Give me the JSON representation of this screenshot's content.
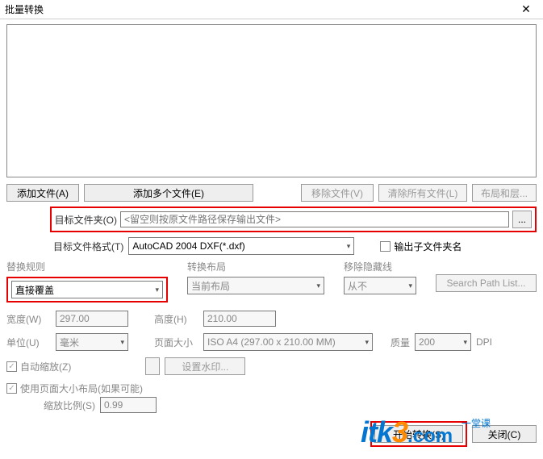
{
  "title": "批量转换",
  "close_icon": "✕",
  "buttons": {
    "add_file": "添加文件(A)",
    "add_multi": "添加多个文件(E)",
    "remove_file": "移除文件(V)",
    "clear_all": "清除所有文件(L)",
    "layout_layer": "布局和层...",
    "browse": "...",
    "watermark": "设置水印...",
    "search_path": "Search Path List...",
    "start": "开始转换(S)",
    "close": "关闭(C)"
  },
  "labels": {
    "target_folder": "目标文件夹(O)",
    "target_format": "目标文件格式(T)",
    "output_subfolder": "输出子文件夹名",
    "replace_rule": "替换规则",
    "convert_layout": "转换布局",
    "remove_hidden": "移除隐藏线",
    "width": "宽度(W)",
    "height": "高度(H)",
    "unit": "单位(U)",
    "page_size": "页面大小",
    "quality": "质量",
    "dpi": "DPI",
    "auto_scale": "自动缩放(Z)",
    "use_page_layout": "使用页面大小布局(如果可能)",
    "scale_ratio": "缩放比例(S)"
  },
  "inputs": {
    "target_folder_placeholder": "<留空则按原文件路径保存输出文件>",
    "target_folder_value": "",
    "width_value": "297.00",
    "height_value": "210.00",
    "scale_value": "0.99"
  },
  "selects": {
    "format_value": "AutoCAD 2004 DXF(*.dxf)",
    "replace_value": "直接覆盖",
    "layout_value": "当前布局",
    "hidden_value": "从不",
    "unit_value": "毫米",
    "pagesize_value": "ISO A4 (297.00 x 210.00 MM)",
    "quality_value": "200"
  },
  "checks": {
    "output_subfolder": false,
    "auto_scale": true,
    "use_page_layout": true
  },
  "watermark": {
    "p1": "itk",
    "p2": "3",
    "p3": ".com",
    "sub": "一堂课"
  }
}
